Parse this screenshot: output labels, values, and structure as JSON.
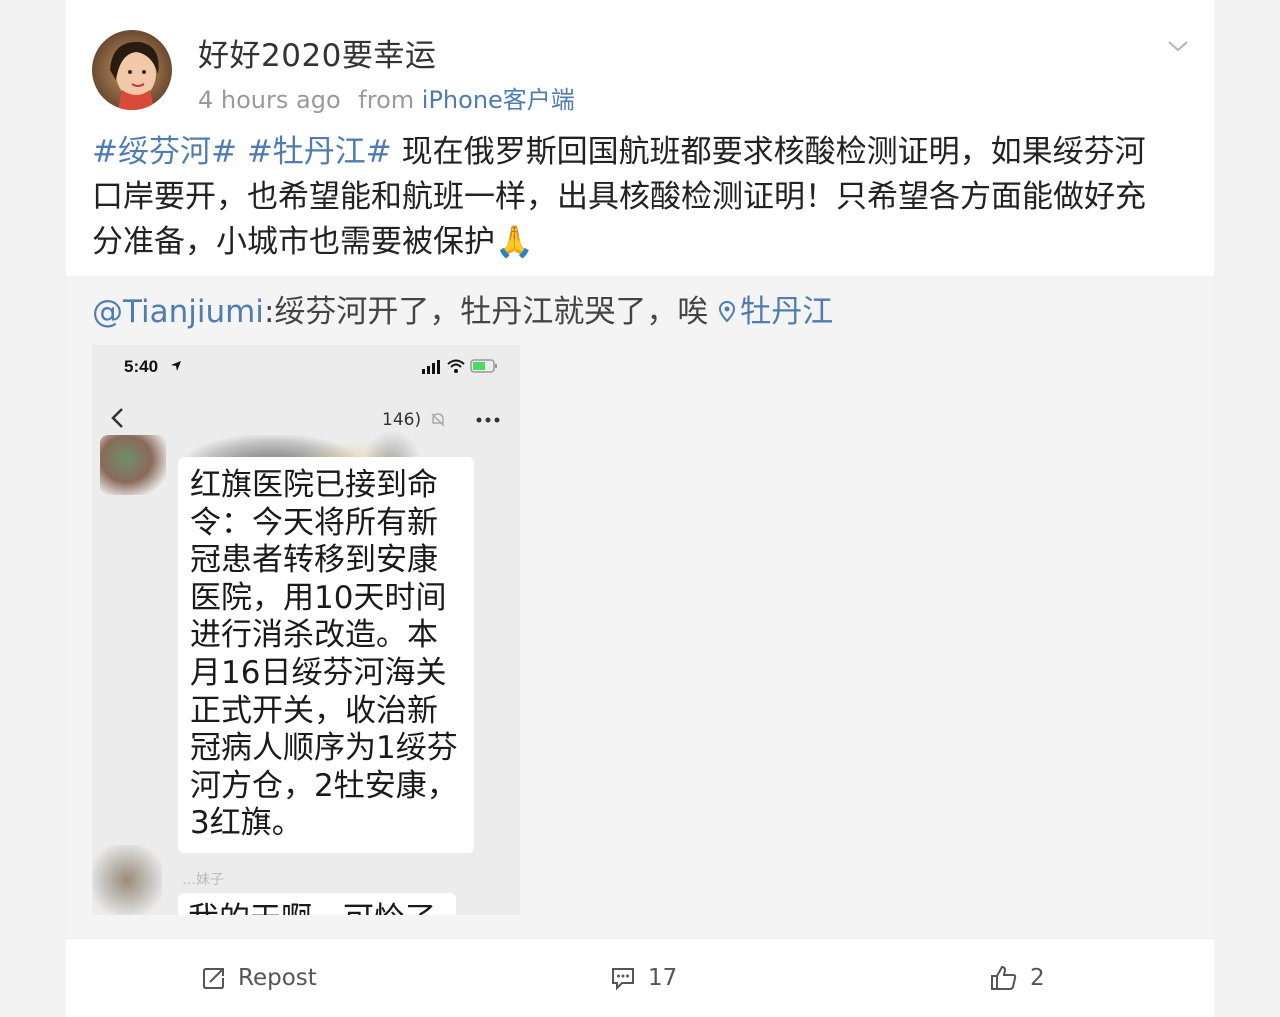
{
  "post": {
    "username": "好好2020要幸运",
    "time": "4 hours ago",
    "from_label": "from",
    "source": "iPhone客户端",
    "hashtags": [
      "#绥芬河#",
      "#牡丹江#"
    ],
    "text": "现在俄罗斯回国航班都要求核酸检测证明，如果绥芬河口岸要开，也希望能和航班一样，出具核酸检测证明！只希望各方面能做好充分准备，小城市也需要被保护",
    "emoji": "🙏"
  },
  "repost": {
    "mention": "@Tianjiumi",
    "text": ":绥芬河开了，牡丹江就哭了，唉",
    "location": "牡丹江"
  },
  "screenshot": {
    "status_time": "5:40",
    "chat_title": "146)",
    "message": "红旗医院已接到命\n令：今天将所有新\n冠患者转移到安康\n医院，用10天时间\n进行消杀改造。本\n月16日绥芬河海关\n正式开关，收治新\n冠病人顺序为1绥芬\n河方仓，2牡安康，\n3红旗。",
    "next_sender": "…妹子",
    "next_message": "我的天啊，可怜了"
  },
  "actions": {
    "repost_label": "Repost",
    "comment_count": "17",
    "like_count": "2"
  },
  "colors": {
    "link": "#507daf",
    "meta": "#9a9a9a",
    "background": "#f2f2f2",
    "repost_background": "#f4f4f4"
  },
  "icons": [
    "chevron-down-icon",
    "location-pin-icon",
    "repost-icon",
    "comment-icon",
    "like-icon",
    "signal-icon",
    "wifi-icon",
    "battery-icon",
    "back-icon",
    "more-icon",
    "mute-icon"
  ]
}
